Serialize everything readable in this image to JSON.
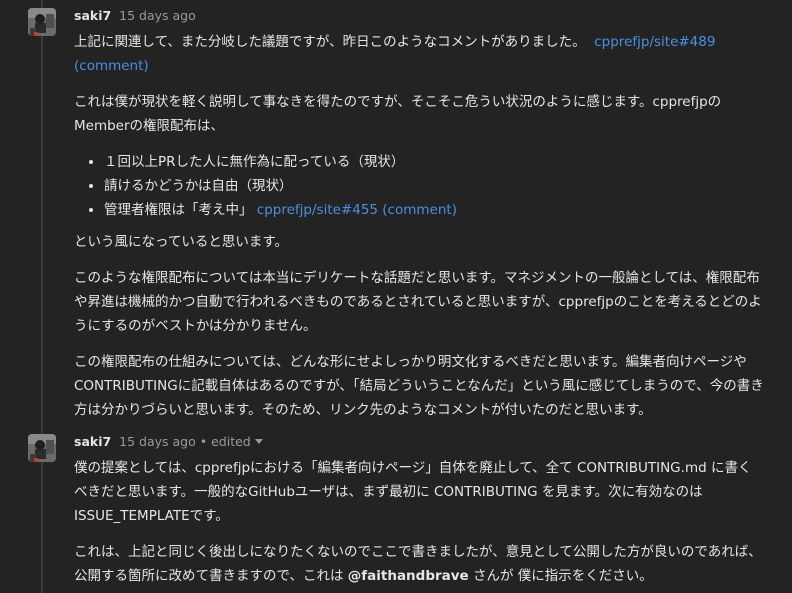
{
  "comments": [
    {
      "author": "saki7",
      "time": "15 days ago",
      "p1": {
        "text": "上記に関連して、また分岐した議題ですが、昨日このようなコメントがありました。",
        "link": "cpprefjp/site#489 (comment)"
      },
      "p2": "これは僕が現状を軽く説明して事なきを得たのですが、そこそこ危うい状況のように感じます。cpprefjpのMemberの権限配布は、",
      "list": [
        {
          "text": "１回以上PRした人に無作為に配っている（現状）"
        },
        {
          "text": "請けるかどうかは自由（現状）"
        },
        {
          "text": "管理者権限は「考え中」",
          "link": "cpprefjp/site#455 (comment)"
        }
      ],
      "p3": "という風になっていると思います。",
      "p4": "このような権限配布については本当にデリケートな話題だと思います。マネジメントの一般論としては、権限配布や昇進は機械的かつ自動で行われるべきものであるとされていると思いますが、cpprefjpのことを考えるとどのようにするのがベストかは分かりません。",
      "p5": "この権限配布の仕組みについては、どんな形にせよしっかり明文化するべきだと思います。編集者向けページやCONTRIBUTINGに記載自体はあるのですが、「結局どういうことなんだ」という風に感じてしまうので、今の書き方は分かりづらいと思います。そのため、リンク先のようなコメントが付いたのだと思います。"
    },
    {
      "author": "saki7",
      "time": "15 days ago",
      "separator": "•",
      "edited": "edited",
      "p1": "僕の提案としては、cpprefjpにおける「編集者向けページ」自体を廃止して、全て CONTRIBUTING.md に書くべきだと思います。一般的なGitHubユーザは、まず最初に CONTRIBUTING を見ます。次に有効なのは ISSUE_TEMPLATEです。",
      "p2": {
        "before": "これは、上記と同じく後出しになりたくないのでここで書きましたが、意見として公開した方が良いのであれば、公開する箇所に改めて書きますので、これは",
        "mention": "@faithandbrave",
        "after": "さんが 僕に指示をください。"
      }
    }
  ]
}
